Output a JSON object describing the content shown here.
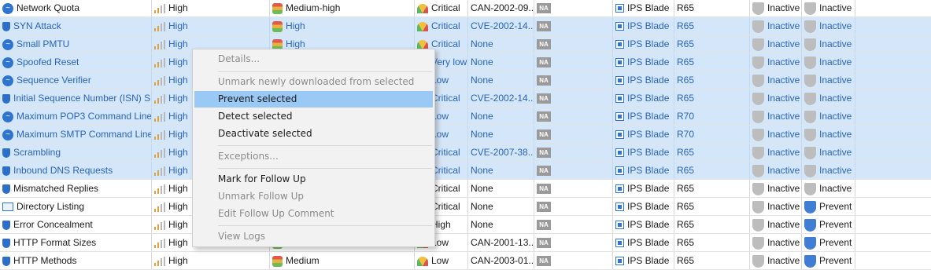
{
  "columns": {
    "name": "",
    "severity": "",
    "performance": "",
    "confidence": "",
    "industry_ref": "",
    "na": "",
    "type": "",
    "version": "",
    "profile1": "",
    "profile2": ""
  },
  "rows": [
    {
      "name": "Network Quota",
      "name_icon": "wave-icon",
      "severity": "High",
      "performance": "Medium-high",
      "confidence": "Critical",
      "industry_ref": "CAN-2002-09...",
      "na": "NA",
      "type": "IPS Blade",
      "version": "R65",
      "profile1": "Inactive",
      "profile1_icon": "shield-gray-icon",
      "profile2": "Inactive",
      "profile2_icon": "shield-gray-icon",
      "selected": false
    },
    {
      "name": "SYN Attack",
      "name_icon": "shield-icon",
      "severity": "High",
      "performance": "High",
      "confidence": "Critical",
      "industry_ref": "CVE-2002-14...",
      "na": "NA",
      "type": "IPS Blade",
      "version": "R65",
      "profile1": "Inactive",
      "profile1_icon": "shield-gray-icon",
      "profile2": "Inactive",
      "profile2_icon": "shield-gray-icon",
      "selected": true
    },
    {
      "name": "Small PMTU",
      "name_icon": "wave-icon",
      "severity": "High",
      "performance": "High",
      "confidence": "Critical",
      "industry_ref": "None",
      "na": "NA",
      "type": "IPS Blade",
      "version": "R65",
      "profile1": "Inactive",
      "profile1_icon": "shield-gray-icon",
      "profile2": "Inactive",
      "profile2_icon": "shield-gray-icon",
      "selected": true
    },
    {
      "name": "Spoofed Reset",
      "name_icon": "wave-icon",
      "severity": "High",
      "performance": "",
      "confidence": "Very low",
      "industry_ref": "None",
      "na": "NA",
      "type": "IPS Blade",
      "version": "R65",
      "profile1": "Inactive",
      "profile1_icon": "shield-gray-icon",
      "profile2": "Inactive",
      "profile2_icon": "shield-gray-icon",
      "selected": true
    },
    {
      "name": "Sequence Verifier",
      "name_icon": "wave-icon",
      "severity": "High",
      "performance": "",
      "confidence": "Low",
      "industry_ref": "None",
      "na": "NA",
      "type": "IPS Blade",
      "version": "R65",
      "profile1": "Inactive",
      "profile1_icon": "shield-gray-icon",
      "profile2": "Inactive",
      "profile2_icon": "shield-gray-icon",
      "selected": true
    },
    {
      "name": "Initial Sequence Number (ISN) S...",
      "name_icon": "shield-icon",
      "severity": "High",
      "performance": "",
      "confidence": "Critical",
      "industry_ref": "CVE-2002-14...",
      "na": "NA",
      "type": "IPS Blade",
      "version": "R65",
      "profile1": "Inactive",
      "profile1_icon": "shield-gray-icon",
      "profile2": "Inactive",
      "profile2_icon": "shield-gray-icon",
      "selected": true
    },
    {
      "name": "Maximum POP3 Command Line L...",
      "name_icon": "wave-icon",
      "severity": "High",
      "performance": "",
      "confidence": "Low",
      "industry_ref": "None",
      "na": "NA",
      "type": "IPS Blade",
      "version": "R70",
      "profile1": "Inactive",
      "profile1_icon": "shield-gray-icon",
      "profile2": "Inactive",
      "profile2_icon": "shield-gray-icon",
      "selected": true
    },
    {
      "name": "Maximum SMTP Command Line ...",
      "name_icon": "wave-icon",
      "severity": "High",
      "performance": "",
      "confidence": "Low",
      "industry_ref": "None",
      "na": "NA",
      "type": "IPS Blade",
      "version": "R70",
      "profile1": "Inactive",
      "profile1_icon": "shield-gray-icon",
      "profile2": "Inactive",
      "profile2_icon": "shield-gray-icon",
      "selected": true
    },
    {
      "name": "Scrambling",
      "name_icon": "shield-icon",
      "severity": "High",
      "performance": "",
      "confidence": "Critical",
      "industry_ref": "CVE-2007-38...",
      "na": "NA",
      "type": "IPS Blade",
      "version": "R65",
      "profile1": "Inactive",
      "profile1_icon": "shield-gray-icon",
      "profile2": "Inactive",
      "profile2_icon": "shield-gray-icon",
      "selected": true
    },
    {
      "name": "Inbound DNS Requests",
      "name_icon": "shield-icon",
      "severity": "High",
      "performance": "",
      "confidence": "Critical",
      "industry_ref": "None",
      "na": "NA",
      "type": "IPS Blade",
      "version": "R65",
      "profile1": "Inactive",
      "profile1_icon": "shield-gray-icon",
      "profile2": "Inactive",
      "profile2_icon": "shield-gray-icon",
      "selected": true
    },
    {
      "name": "Mismatched Replies",
      "name_icon": "shield-icon",
      "severity": "High",
      "performance": "",
      "confidence": "Critical",
      "industry_ref": "None",
      "na": "NA",
      "type": "IPS Blade",
      "version": "R65",
      "profile1": "Inactive",
      "profile1_icon": "shield-gray-icon",
      "profile2": "Inactive",
      "profile2_icon": "shield-gray-icon",
      "selected": false
    },
    {
      "name": "Directory Listing",
      "name_icon": "directory-icon",
      "severity": "High",
      "performance": "",
      "confidence": "Critical",
      "industry_ref": "None",
      "na": "NA",
      "type": "IPS Blade",
      "version": "R65",
      "profile1": "Inactive",
      "profile1_icon": "shield-gray-icon",
      "profile2": "Prevent",
      "profile2_icon": "shield-blue-icon",
      "selected": false
    },
    {
      "name": "Error Concealment",
      "name_icon": "shield-icon",
      "severity": "High",
      "performance": "",
      "confidence": "High",
      "industry_ref": "None",
      "na": "NA",
      "type": "IPS Blade",
      "version": "R65",
      "profile1": "Inactive",
      "profile1_icon": "shield-gray-icon",
      "profile2": "Prevent",
      "profile2_icon": "shield-blue-icon",
      "selected": false
    },
    {
      "name": "HTTP Format Sizes",
      "name_icon": "shield-icon",
      "severity": "High",
      "performance": "",
      "confidence": "Low",
      "industry_ref": "CAN-2001-13...",
      "na": "NA",
      "type": "IPS Blade",
      "version": "R65",
      "profile1": "Inactive",
      "profile1_icon": "shield-gray-icon",
      "profile2": "Prevent",
      "profile2_icon": "shield-blue-icon",
      "selected": false
    },
    {
      "name": "HTTP Methods",
      "name_icon": "shield-icon",
      "severity": "High",
      "performance": "Medium",
      "confidence": "Low",
      "industry_ref": "CAN-2003-01...",
      "na": "NA",
      "type": "IPS Blade",
      "version": "R65",
      "profile1": "Inactive",
      "profile1_icon": "shield-gray-icon",
      "profile2": "Prevent",
      "profile2_icon": "shield-blue-icon",
      "selected": false
    }
  ],
  "context_menu": {
    "items": [
      {
        "label": "Details...",
        "enabled": false
      },
      {
        "label": "Unmark newly downloaded from selected",
        "enabled": false
      },
      {
        "label": "Prevent selected",
        "enabled": true,
        "highlighted": true
      },
      {
        "label": "Detect selected",
        "enabled": true
      },
      {
        "label": "Deactivate selected",
        "enabled": true
      },
      {
        "label": "Exceptions...",
        "enabled": false
      },
      {
        "label": "Mark for Follow Up",
        "enabled": true
      },
      {
        "label": "Unmark Follow Up",
        "enabled": false
      },
      {
        "label": "Edit Follow Up Comment",
        "enabled": false
      },
      {
        "label": "View Logs",
        "enabled": false
      }
    ]
  },
  "colors": {
    "selection_bg": "#d4e7fa",
    "selection_text": "#2a63b8",
    "menu_highlight": "#99c9f4",
    "active_shield": "#3f7ed4",
    "inactive_shield": "#bdbdbd"
  }
}
